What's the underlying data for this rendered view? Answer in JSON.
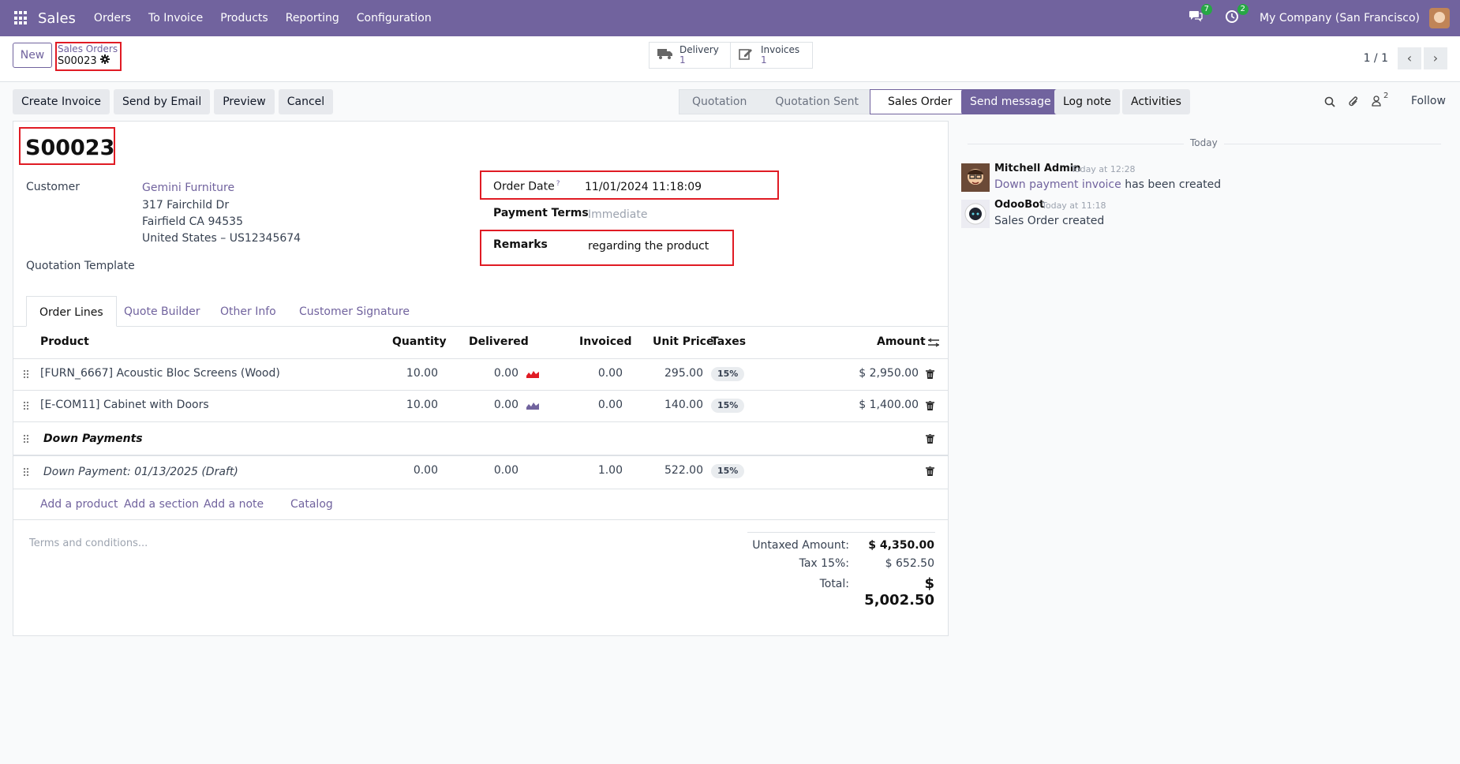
{
  "navbar": {
    "app_name": "Sales",
    "menu": [
      "Orders",
      "To Invoice",
      "Products",
      "Reporting",
      "Configuration"
    ],
    "messages_badge": "7",
    "activities_badge": "2",
    "company": "My Company (San Francisco)",
    "brand_color": "#71639e"
  },
  "control_panel": {
    "new_label": "New",
    "breadcrumb_parent": "Sales Orders",
    "breadcrumb_current": "S00023",
    "delivery_label": "Delivery",
    "delivery_count": "1",
    "invoices_label": "Invoices",
    "invoices_count": "1",
    "pager_value": "1 / 1"
  },
  "actions": {
    "create_invoice": "Create Invoice",
    "send_by_email": "Send by Email",
    "preview": "Preview",
    "cancel": "Cancel"
  },
  "statusbar": [
    "Quotation",
    "Quotation Sent",
    "Sales Order"
  ],
  "statusbar_active": "Sales Order",
  "form": {
    "name": "S00023",
    "customer_label": "Customer",
    "customer_name": "Gemini Furniture",
    "customer_address": [
      "317 Fairchild Dr",
      "Fairfield CA 94535",
      "United States – US12345674"
    ],
    "quotation_template_label": "Quotation Template",
    "order_date_label": "Order Date",
    "order_date_help": "?",
    "order_date_value": "11/01/2024 11:18:09",
    "payment_terms_label": "Payment Terms",
    "payment_terms_placeholder": "Immediate",
    "remarks_label": "Remarks",
    "remarks_value": "regarding the product"
  },
  "tabs": [
    "Order Lines",
    "Quote Builder",
    "Other Info",
    "Customer Signature"
  ],
  "order_lines": {
    "headers": {
      "product": "Product",
      "quantity": "Quantity",
      "delivered": "Delivered",
      "invoiced": "Invoiced",
      "unit_price": "Unit Price",
      "taxes": "Taxes",
      "amount": "Amount"
    },
    "rows": [
      {
        "product": "[FURN_6667] Acoustic Bloc Screens (Wood)",
        "quantity": "10.00",
        "delivered": "0.00",
        "invoiced": "0.00",
        "unit_price": "295.00",
        "tax": "15%",
        "amount": "$ 2,950.00",
        "forecast_color": "#e01b24"
      },
      {
        "product": "[E-COM11] Cabinet with Doors",
        "quantity": "10.00",
        "delivered": "0.00",
        "invoiced": "0.00",
        "unit_price": "140.00",
        "tax": "15%",
        "amount": "$ 1,400.00",
        "forecast_color": "#71639e"
      }
    ],
    "section": "Down Payments",
    "down_payment": {
      "product": "Down Payment: 01/13/2025 (Draft)",
      "quantity": "0.00",
      "delivered": "0.00",
      "invoiced": "1.00",
      "unit_price": "522.00",
      "tax": "15%"
    },
    "add_product": "Add a product",
    "add_section": "Add a section",
    "add_note": "Add a note",
    "catalog": "Catalog"
  },
  "terms_placeholder": "Terms and conditions...",
  "totals": {
    "untaxed_label": "Untaxed Amount:",
    "untaxed_value": "$ 4,350.00",
    "tax_label": "Tax 15%:",
    "tax_value": "$ 652.50",
    "total_label": "Total:",
    "total_value": "$ 5,002.50"
  },
  "chatter": {
    "send_message": "Send message",
    "log_note": "Log note",
    "activities": "Activities",
    "followers_count": "2",
    "follow": "Follow",
    "date_separator": "Today",
    "messages": [
      {
        "author": "Mitchell Admin",
        "time": "Today at 12:28",
        "link": "Down payment invoice",
        "text": " has been created"
      },
      {
        "author": "OdooBot",
        "time": "Today at 11:18",
        "text": "Sales Order created"
      }
    ]
  }
}
